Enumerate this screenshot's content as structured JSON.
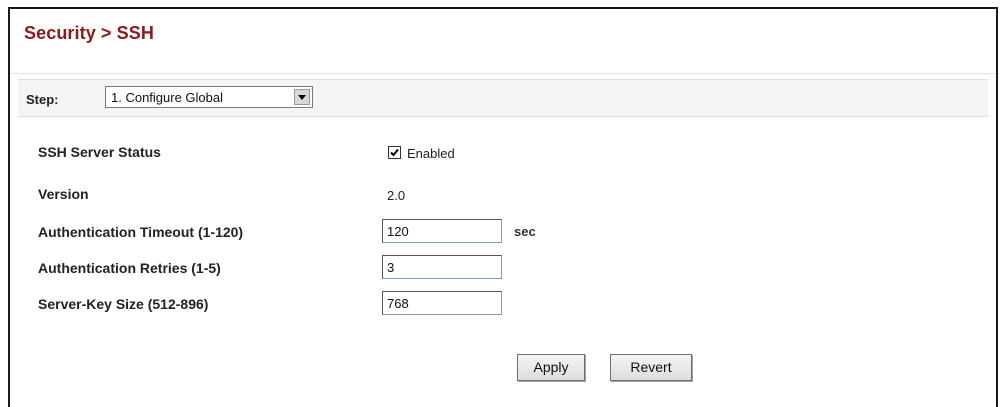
{
  "header": {
    "title": "Security > SSH"
  },
  "step": {
    "label": "Step:",
    "selected": "1. Configure Global"
  },
  "form": {
    "ssh_status": {
      "label": "SSH Server Status",
      "checked": true,
      "checkbox_label": "Enabled"
    },
    "version": {
      "label": "Version",
      "value": "2.0"
    },
    "auth_timeout": {
      "label": "Authentication Timeout (1-120)",
      "value": "120",
      "unit": "sec"
    },
    "auth_retries": {
      "label": "Authentication Retries (1-5)",
      "value": "3"
    },
    "server_key_size": {
      "label": "Server-Key Size (512-896)",
      "value": "768"
    }
  },
  "actions": {
    "apply_label": "Apply",
    "revert_label": "Revert"
  },
  "colors": {
    "title": "#8b1a1a",
    "text": "#222222",
    "step_bar_bg": "#f4f4f4"
  }
}
